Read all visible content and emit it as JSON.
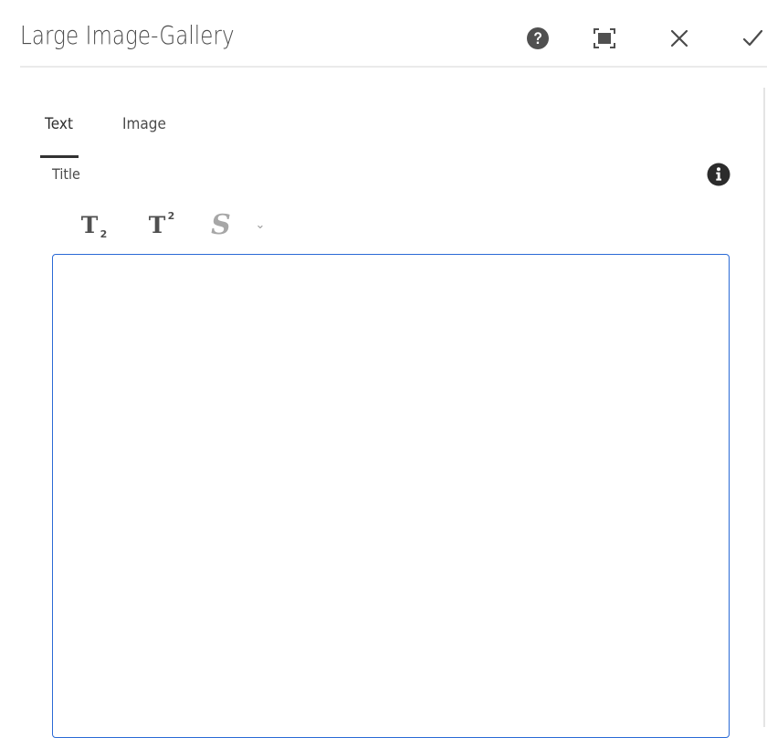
{
  "dialog": {
    "title": "Large Image-Gallery",
    "buttons": {
      "help_icon": "help-icon",
      "fullscreen_icon": "fullscreen-icon",
      "close_icon": "close-icon",
      "done_icon": "checkmark-icon"
    }
  },
  "tabs": [
    {
      "label": "Text",
      "selected": true
    },
    {
      "label": "Image",
      "selected": false
    }
  ],
  "field": {
    "label": "Title",
    "info_icon": "info-icon"
  },
  "toolbar": {
    "subscript": {
      "glyph": "T",
      "mark": "2",
      "icon": "subscript-icon"
    },
    "superscript": {
      "glyph": "T",
      "mark": "2",
      "icon": "superscript-icon"
    },
    "strikethrough": {
      "glyph": "S",
      "icon": "strikethrough-icon",
      "enabled": false
    },
    "more": {
      "glyph": "⌄",
      "icon": "chevron-down-icon"
    }
  },
  "editor": {
    "value": ""
  },
  "colors": {
    "editor_border": "#2a6ad6",
    "tab_indicator": "#323232",
    "text": "#4b4b4b"
  }
}
